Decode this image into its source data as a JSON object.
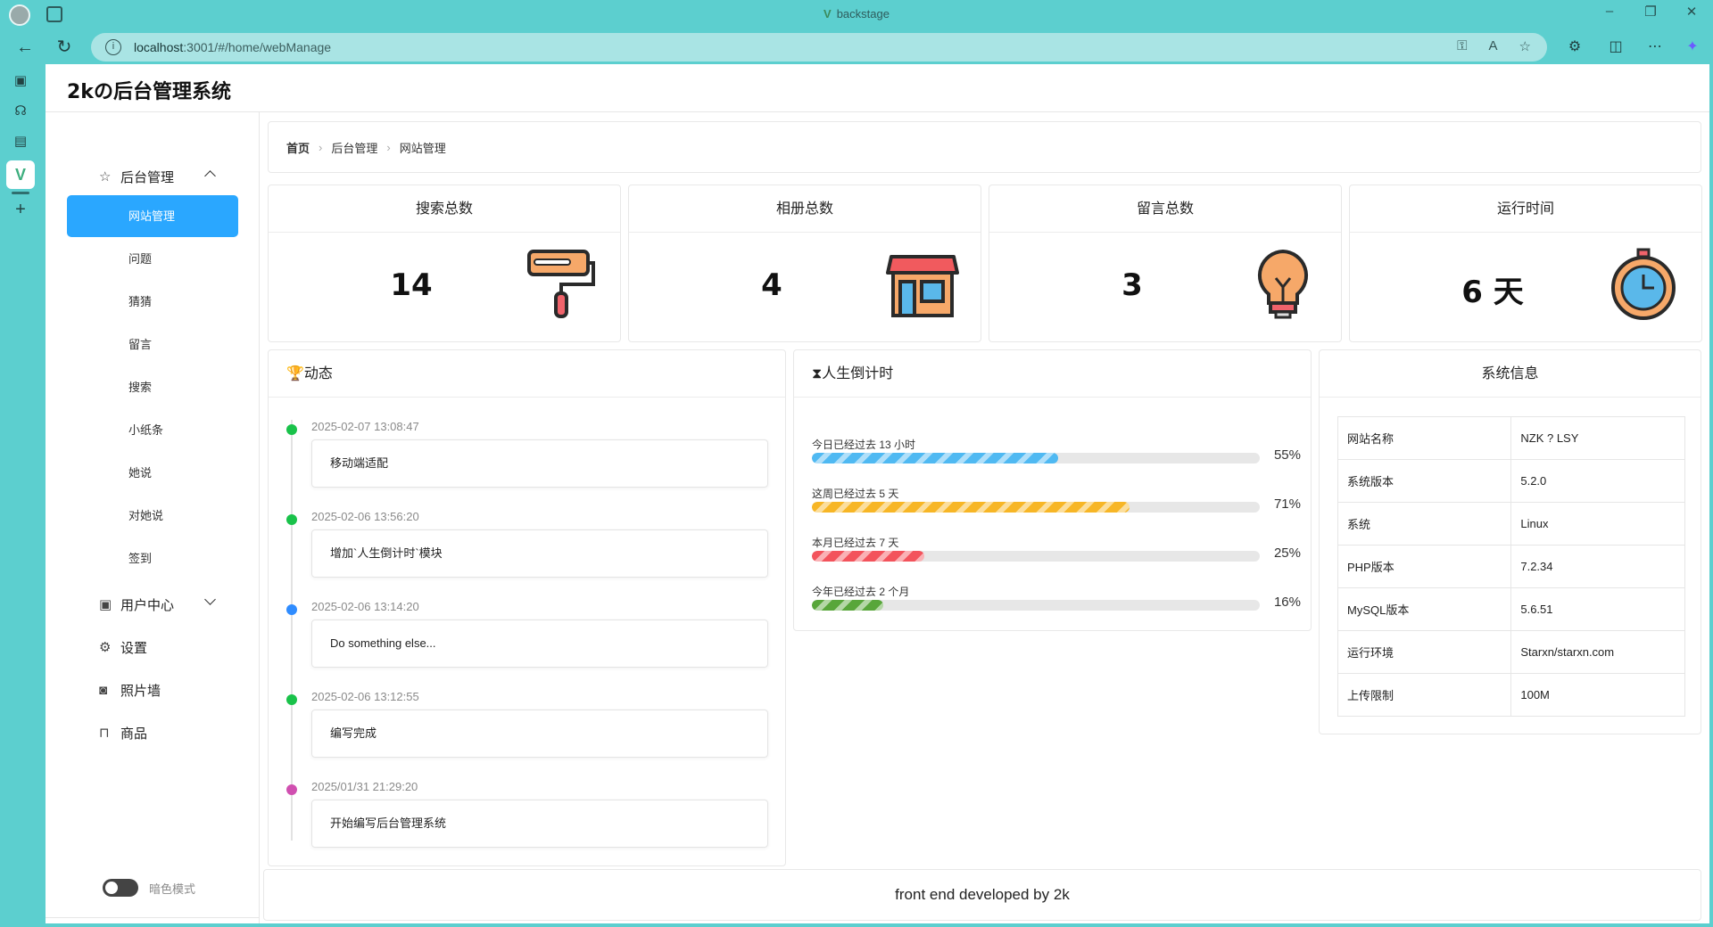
{
  "browser": {
    "tab_title": "backstage",
    "url_host": "localhost",
    "url_rest": ":3001/#/home/webManage"
  },
  "app": {
    "title": "2kの后台管理系统"
  },
  "sidebar": {
    "group_admin": "后台管理",
    "items": [
      "网站管理",
      "问题",
      "猜猜",
      "留言",
      "搜索",
      "小纸条",
      "她说",
      "对她说",
      "签到"
    ],
    "group_user": "用户中心",
    "settings": "设置",
    "photo_wall": "照片墙",
    "goods": "商品",
    "dark_mode": "暗色模式"
  },
  "breadcrumb": [
    "首页",
    "后台管理",
    "网站管理"
  ],
  "stats": [
    {
      "title": "搜索总数",
      "value": "14",
      "icon": "paint-roller-icon"
    },
    {
      "title": "相册总数",
      "value": "4",
      "icon": "store-icon"
    },
    {
      "title": "留言总数",
      "value": "3",
      "icon": "lightbulb-icon"
    },
    {
      "title": "运行时间",
      "value": "6 天",
      "icon": "stopwatch-icon"
    }
  ],
  "activity": {
    "title": "动态",
    "items": [
      {
        "time": "2025-02-07 13:08:47",
        "text": "移动端适配",
        "color": "#19c24a"
      },
      {
        "time": "2025-02-06 13:56:20",
        "text": "增加`人生倒计时`模块",
        "color": "#19c24a"
      },
      {
        "time": "2025-02-06 13:14:20",
        "text": "Do something else...",
        "color": "#2f8cff"
      },
      {
        "time": "2025-02-06 13:12:55",
        "text": "编写完成",
        "color": "#19c24a"
      },
      {
        "time": "2025/01/31 21:29:20",
        "text": "开始编写后台管理系统",
        "color": "#d04fb0"
      }
    ]
  },
  "countdown": {
    "title": "人生倒计时",
    "rows": [
      {
        "label": "今日已经过去 13 小时",
        "percent": 55,
        "pct_text": "55%",
        "color": "#4fb9f2"
      },
      {
        "label": "这周已经过去 5 天",
        "percent": 71,
        "pct_text": "71%",
        "color": "#f7b626"
      },
      {
        "label": "本月已经过去 7 天",
        "percent": 25,
        "pct_text": "25%",
        "color": "#f3535c"
      },
      {
        "label": "今年已经过去 2 个月",
        "percent": 16,
        "pct_text": "16%",
        "color": "#58a63a"
      }
    ]
  },
  "sysinfo": {
    "title": "系统信息",
    "rows": [
      {
        "k": "网站名称",
        "v": "NZK ? LSY"
      },
      {
        "k": "系统版本",
        "v": "5.2.0"
      },
      {
        "k": "系统",
        "v": "Linux"
      },
      {
        "k": "PHP版本",
        "v": "7.2.34"
      },
      {
        "k": "MySQL版本",
        "v": "5.6.51"
      },
      {
        "k": "运行环境",
        "v": "Starxn/starxn.com"
      },
      {
        "k": "上传限制",
        "v": "100M"
      }
    ]
  },
  "footer": "front end developed by 2k"
}
